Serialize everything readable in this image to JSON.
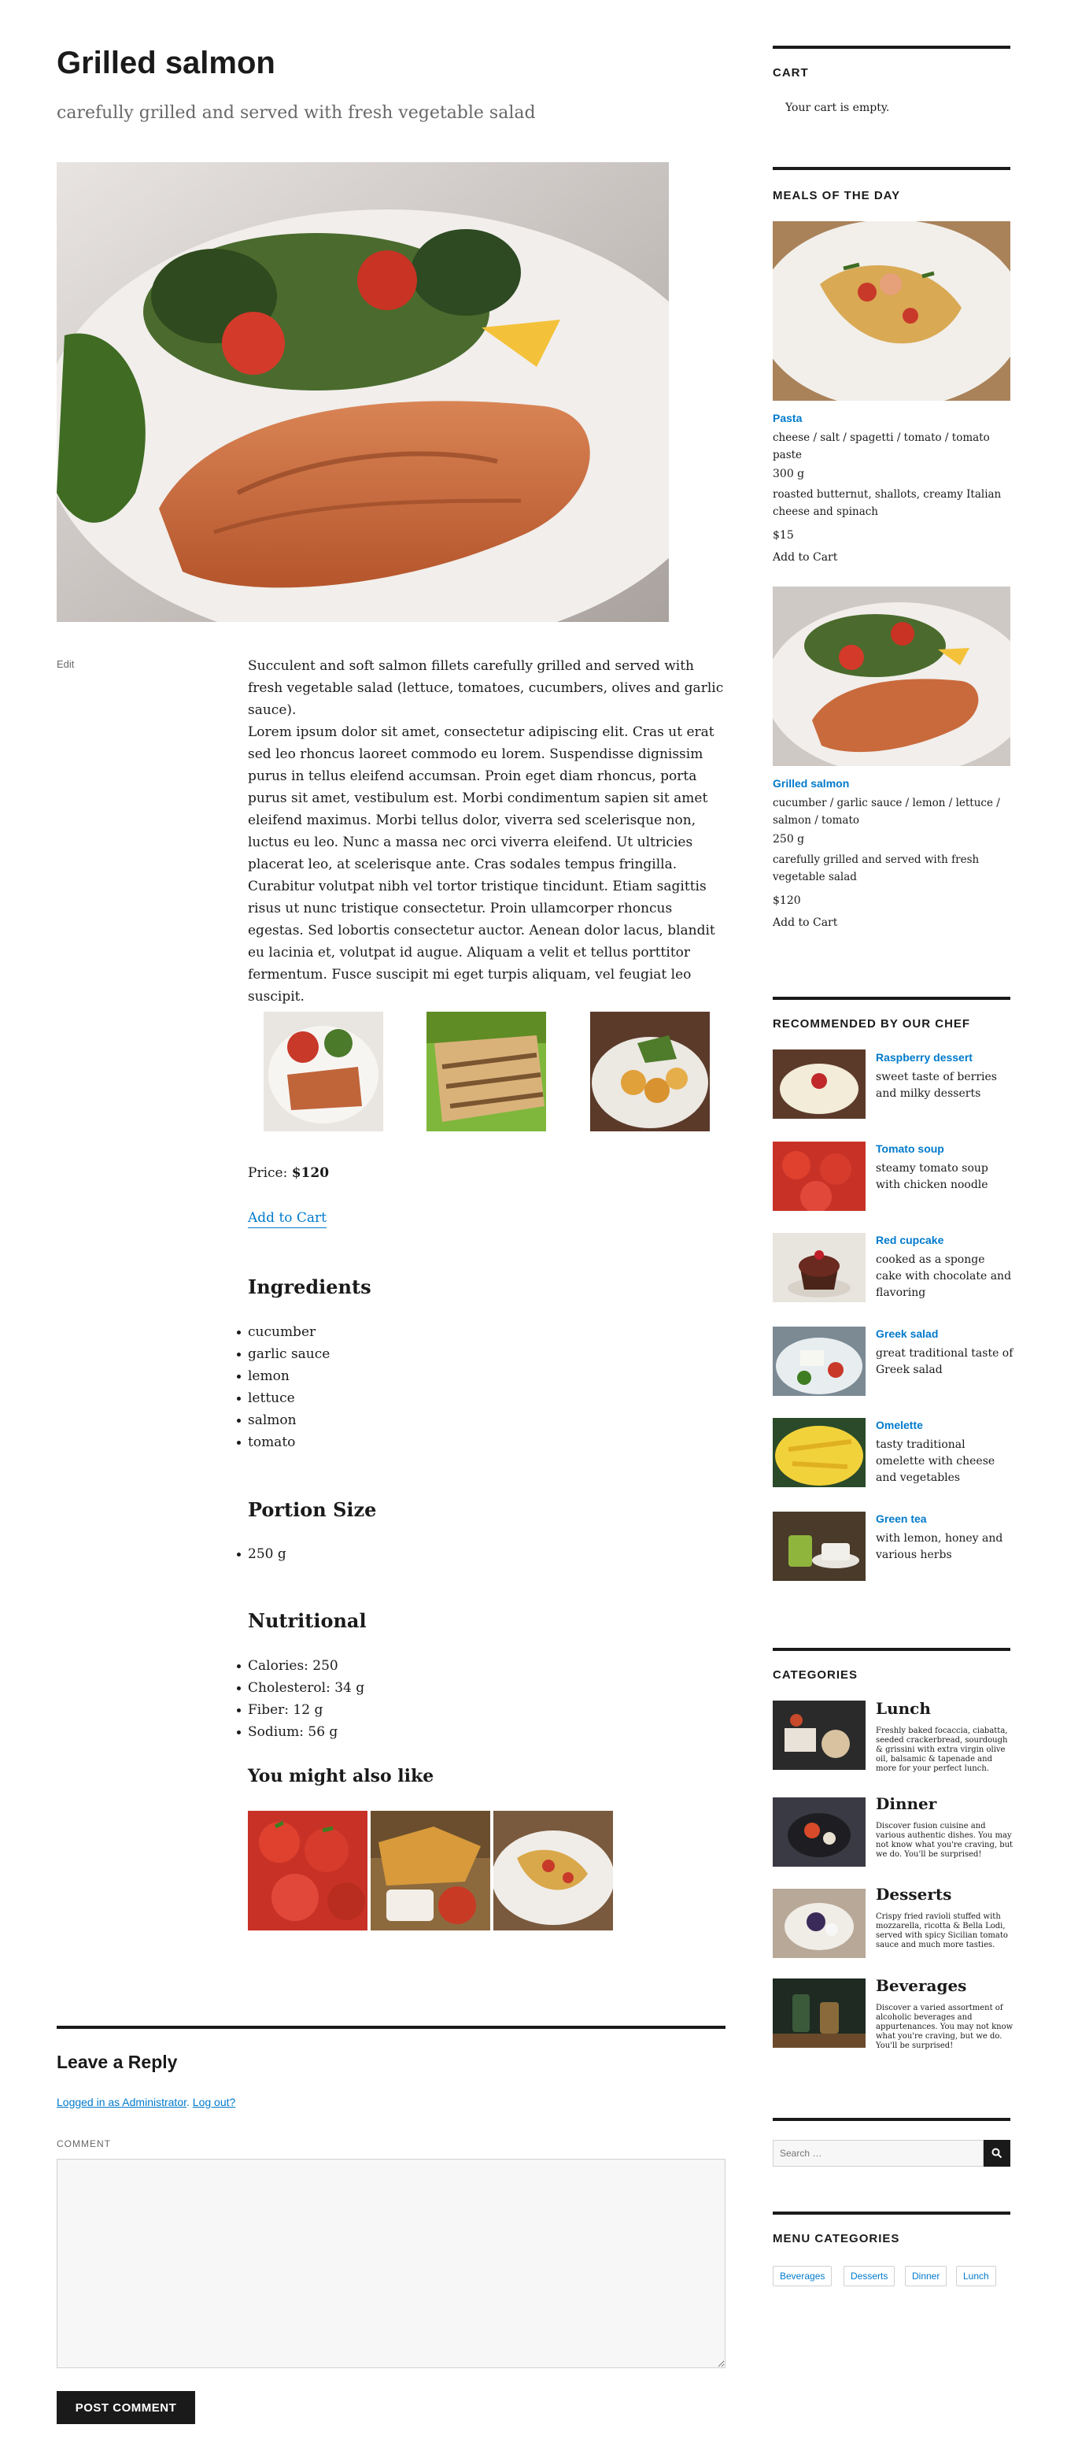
{
  "post": {
    "title": "Grilled salmon",
    "subtitle": "carefully grilled and served with fresh vegetable salad",
    "edit": "Edit",
    "para1": "Succulent and soft salmon fillets carefully grilled and served with fresh vegetable salad (lettuce, tomatoes, cucumbers, olives and garlic sauce).",
    "para2": "Lorem ipsum dolor sit amet, consectetur adipiscing elit. Cras ut erat sed leo rhoncus laoreet commodo eu lorem. Suspendisse dignissim purus in tellus eleifend accumsan. Proin eget diam rhoncus, porta purus sit amet, vestibulum est. Morbi condimentum sapien sit amet eleifend maximus. Morbi tellus dolor, viverra sed scelerisque non, luctus eu leo. Nunc a massa nec orci viverra eleifend. Ut ultricies placerat leo, at scelerisque ante. Cras sodales tempus fringilla. Curabitur volutpat nibh vel tortor tristique tincidunt. Etiam sagittis risus ut nunc tristique consectetur. Proin ullamcorper rhoncus egestas. Sed lobortis consectetur auctor. Aenean dolor lacus, blandit eu lacinia et, volutpat id augue. Aliquam a velit et tellus porttitor fermentum. Fusce suscipit mi eget turpis aliquam, vel feugiat leo suscipit.",
    "price_label": "Price:",
    "price_value": "$120",
    "add_to_cart": "Add to Cart",
    "ingredients_title": "Ingredients",
    "ingredients": [
      "cucumber",
      "garlic sauce",
      "lemon",
      "lettuce",
      "salmon",
      "tomato"
    ],
    "portion_title": "Portion Size",
    "portion": [
      "250 g"
    ],
    "nutritional_title": "Nutritional",
    "nutritional": [
      "Calories: 250",
      "Cholesterol: 34 g",
      "Fiber: 12 g",
      "Sodium: 56 g"
    ],
    "related_title": "You might also like"
  },
  "reply": {
    "title": "Leave a Reply",
    "logged_in": "Logged in as Administrator",
    "separator": ". ",
    "logout": "Log out?",
    "comment_label": "COMMENT",
    "submit": "POST COMMENT"
  },
  "sidebar": {
    "cart_title": "CART",
    "cart_empty": "Your cart is empty.",
    "meals_title": "MEALS OF THE DAY",
    "meals": [
      {
        "name": "Pasta",
        "tags": "cheese / salt / spagetti / tomato / tomato paste",
        "portion": "300 g",
        "desc": "roasted butternut, shallots, creamy Italian cheese and spinach",
        "price": "$15",
        "cta": "Add to Cart"
      },
      {
        "name": "Grilled salmon",
        "tags": "cucumber / garlic sauce / lemon / lettuce / salmon / tomato",
        "portion": "250 g",
        "desc": "carefully grilled and served with fresh vegetable salad",
        "price": "$120",
        "cta": "Add to Cart"
      }
    ],
    "chef_title": "RECOMMENDED BY OUR CHEF",
    "chef": [
      {
        "name": "Raspberry dessert",
        "desc": "sweet taste of berries and milky desserts"
      },
      {
        "name": "Tomato soup",
        "desc": "steamy tomato soup with chicken noodle"
      },
      {
        "name": "Red cupcake",
        "desc": "cooked as a sponge cake with chocolate and flavoring"
      },
      {
        "name": "Greek salad",
        "desc": "great traditional taste of Greek salad"
      },
      {
        "name": "Omelette",
        "desc": "tasty traditional omelette with cheese and vegetables"
      },
      {
        "name": "Green tea",
        "desc": "with lemon, honey and various herbs"
      }
    ],
    "categories_title": "CATEGORIES",
    "categories": [
      {
        "name": "Lunch",
        "desc": "Freshly baked focaccia, ciabatta, seeded crackerbread, sourdough & grissini with extra virgin olive oil, balsamic & tapenade and more for your perfect lunch."
      },
      {
        "name": "Dinner",
        "desc": "Discover fusion cuisine and various authentic dishes. You may not know what you're craving, but we do. You'll be surprised!"
      },
      {
        "name": "Desserts",
        "desc": "Crispy fried ravioli stuffed with mozzarella, ricotta & Bella Lodi, served with spicy Sicilian tomato sauce and much more tasties."
      },
      {
        "name": "Beverages",
        "desc": "Discover a varied assortment of alcoholic beverages and appurtenances. You may not know what you're craving, but we do. You'll be surprised!"
      }
    ],
    "search_placeholder": "Search …",
    "menu_categories_title": "MENU CATEGORIES",
    "menu_tags": [
      "Beverages",
      "Desserts",
      "Dinner",
      "Lunch"
    ]
  },
  "icons": {
    "search": "search-icon"
  },
  "colors": {
    "link": "#007acc",
    "text": "#1a1a1a",
    "muted": "#686868"
  }
}
